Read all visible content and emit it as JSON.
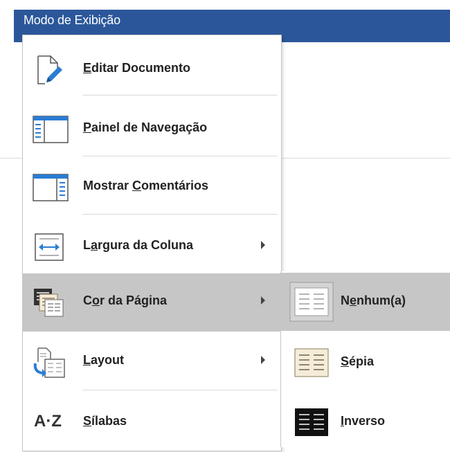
{
  "header": {
    "title": "Modo de Exibição"
  },
  "menu": {
    "items": [
      {
        "pre": "",
        "key": "E",
        "post": "ditar Documento",
        "icon": "edit-document-icon"
      },
      {
        "pre": "",
        "key": "P",
        "post": "ainel de Navegação",
        "icon": "navigation-pane-icon"
      },
      {
        "pre": "Mostrar ",
        "key": "C",
        "post": "omentários",
        "icon": "show-comments-icon"
      },
      {
        "pre": "L",
        "key": "a",
        "post": "rgura da Coluna",
        "icon": "column-width-icon"
      },
      {
        "pre": "C",
        "key": "o",
        "post": "r da Página",
        "icon": "page-color-icon"
      },
      {
        "pre": "",
        "key": "L",
        "post": "ayout",
        "icon": "layout-icon"
      },
      {
        "pre": "",
        "key": "S",
        "post": "ílabas",
        "icon": "syllables-icon"
      }
    ]
  },
  "submenu": {
    "items": [
      {
        "pre": "N",
        "key": "e",
        "post": "nhum(a)",
        "color": "#ffffff",
        "lines": "#9a9a9a"
      },
      {
        "pre": "",
        "key": "S",
        "post": "épia",
        "color": "#f4ecd8",
        "lines": "#8a7a5a"
      },
      {
        "pre": "",
        "key": "I",
        "post": "nverso",
        "color": "#111111",
        "lines": "#ffffff"
      }
    ]
  },
  "icons": {
    "syllables_text": "A·Z"
  },
  "colors": {
    "title_bar": "#2b579a",
    "selected_bg": "#c6c6c6",
    "icon_blue": "#2b7cd3"
  }
}
